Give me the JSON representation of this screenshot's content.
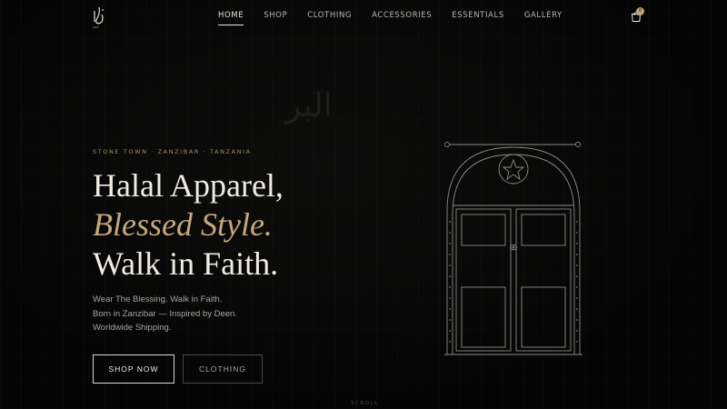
{
  "nav": {
    "links": [
      "HOME",
      "SHOP",
      "CLOTHING",
      "ACCESSORIES",
      "ESSENTIALS",
      "GALLERY"
    ],
    "active": "HOME",
    "cart_count": "0"
  },
  "icons": {
    "logo": "arabic-calligraphy-logo",
    "cart": "shopping-bag-icon",
    "door": "zanzibar-door-illustration"
  },
  "watermark": "البر",
  "hero": {
    "location": "STONE TOWN · ZANZIBAR · TANZANIA",
    "line1": "Halal Apparel,",
    "line2": "Blessed Style.",
    "line3": "Walk in Faith.",
    "tagline": [
      "Wear The Blessing. Walk in Faith.",
      "Born in Zanzibar — Inspired by Deen.",
      "Worldwide Shipping."
    ],
    "primary_button": "SHOP NOW",
    "secondary_button": "CLOTHING"
  },
  "scroll_label": "SCROLL",
  "colors": {
    "background": "#050505",
    "accent_gold": "#c5a77c",
    "text": "#f0ece4"
  }
}
